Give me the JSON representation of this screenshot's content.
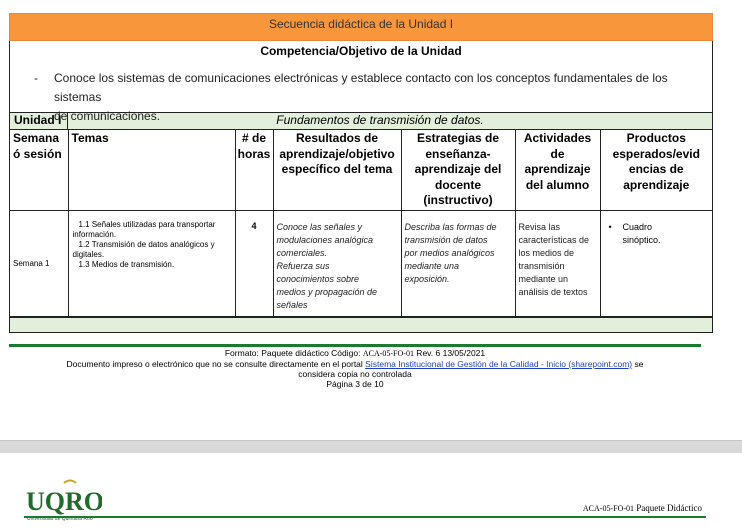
{
  "header": {
    "title": "Secuencia didáctica de la Unidad I"
  },
  "competencia": {
    "title": "Competencia/Objetivo de la Unidad",
    "bullet": "-",
    "text_line1": "Conoce los sistemas de comunicaciones electrónicas y establece contacto con los conceptos fundamentales de los sistemas",
    "text_line2": "de comunicaciones."
  },
  "unidad": {
    "label": "Unidad  I",
    "name": "Fundamentos de transmisión de datos."
  },
  "table": {
    "headers": {
      "semana": [
        "Semana",
        "ó sesión"
      ],
      "temas": "Temas",
      "horas": [
        "# de",
        "horas"
      ],
      "resultados": [
        "Resultados de",
        "aprendizaje/objetivo",
        "específico del tema"
      ],
      "estrategias": [
        "Estrategias de",
        "enseñanza-",
        "aprendizaje del",
        "docente",
        "(instructivo)"
      ],
      "actividades": [
        "Actividades de",
        "aprendizaje",
        "del alumno"
      ],
      "productos": [
        "Productos",
        "esperados/evid",
        "encias de",
        "aprendizaje"
      ]
    },
    "row": {
      "semana": "Semana 1",
      "temas": [
        "1.1 Señales utilizadas para transportar información.",
        "1.2 Transmisión de datos analógicos y digitales.",
        "1.3 Medios de transmisión."
      ],
      "horas": "4",
      "resultados": [
        "Conoce las señales y",
        "modulaciones analógica",
        "comerciales.",
        "Refuerza sus",
        "conocimientos sobre",
        "medios y propagación de",
        "señales"
      ],
      "estrategias": [
        "Describa las formas de",
        "transmisión de datos",
        "por medios analógicos",
        "mediante una",
        "exposición."
      ],
      "actividades": [
        "Revisa las",
        "características de",
        "los medios de",
        "transmisión",
        "mediante un",
        "análisis de textos"
      ],
      "productos_bullet": "•",
      "productos": [
        "Cuadro",
        "sinóptico."
      ]
    }
  },
  "footer": {
    "line1_prefix": "Formato: Paquete didáctico Código: ",
    "code": "ACA-05-FO-01",
    "line1_suffix": "  Rev. 6 13/05/2021",
    "line2_prefix": "Documento impreso o electrónico que no se consulte directamente en el portal ",
    "link": "Sistema Institucional de Gestión de la Calidad - Inicio (sharepoint.com)",
    "line2_suffix": " se",
    "line3": "considera copia no controlada",
    "page": "Página 3 de 10"
  },
  "page2": {
    "logo_text": "UQROO",
    "logo_subtitle": "Universidad de Quintana Roo",
    "code": "ACA-05-FO-01",
    "label": " Paquete Didáctico"
  },
  "colors": {
    "header_orange": "#f7963a",
    "band_green": "#e2efda",
    "rule_green": "#1a7a2e"
  }
}
